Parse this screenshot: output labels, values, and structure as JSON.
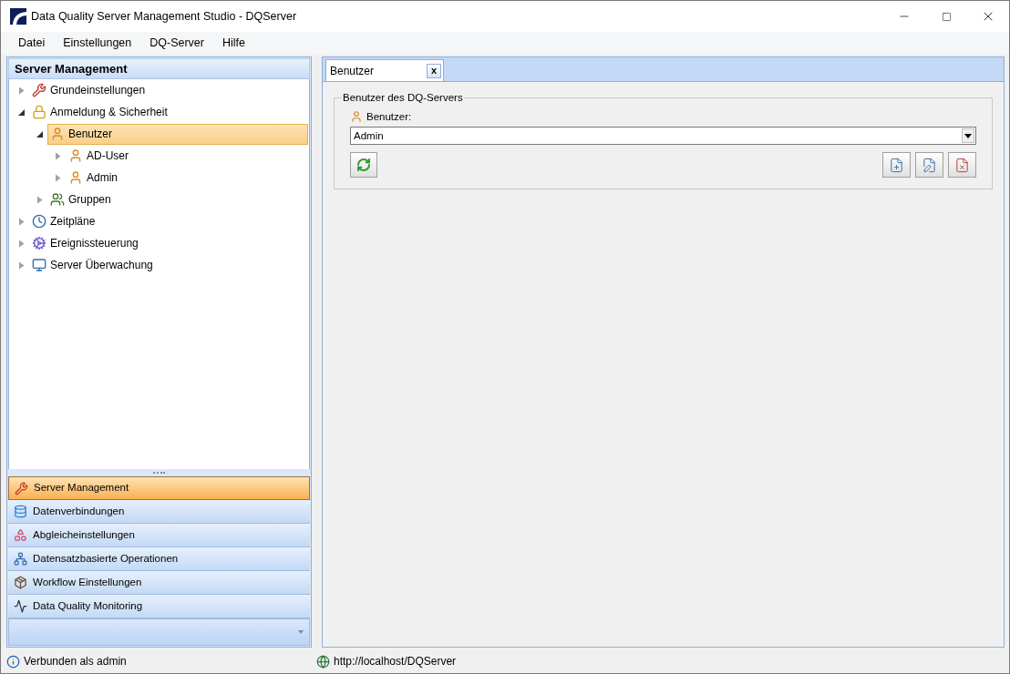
{
  "window": {
    "title": "Data Quality Server Management Studio - DQServer"
  },
  "menu": [
    "Datei",
    "Einstellungen",
    "DQ-Server",
    "Hilfe"
  ],
  "sidebar": {
    "title": "Server Management",
    "tree": [
      {
        "label": "Grundeinstellungen",
        "expanded": false,
        "selected": false
      },
      {
        "label": "Anmeldung & Sicherheit",
        "expanded": true,
        "selected": false,
        "children": [
          {
            "label": "Benutzer",
            "expanded": true,
            "selected": true,
            "children": [
              {
                "label": "AD-User",
                "expanded": false,
                "selected": false
              },
              {
                "label": "Admin",
                "expanded": false,
                "selected": false
              }
            ]
          },
          {
            "label": "Gruppen",
            "expanded": false,
            "selected": false
          }
        ]
      },
      {
        "label": "Zeitpläne",
        "expanded": false,
        "selected": false
      },
      {
        "label": "Ereignissteuerung",
        "expanded": false,
        "selected": false
      },
      {
        "label": "Server Überwachung",
        "expanded": false,
        "selected": false
      }
    ],
    "nav": [
      {
        "label": "Server Management",
        "selected": true
      },
      {
        "label": "Datenverbindungen",
        "selected": false
      },
      {
        "label": "Abgleicheinstellungen",
        "selected": false
      },
      {
        "label": "Datensatzbasierte Operationen",
        "selected": false
      },
      {
        "label": "Workflow Einstellungen",
        "selected": false
      },
      {
        "label": "Data Quality Monitoring",
        "selected": false
      }
    ]
  },
  "tabs": [
    {
      "label": "Benutzer",
      "selected": true,
      "close": "x"
    }
  ],
  "group": {
    "title": "Benutzer des DQ-Servers",
    "field_label": "Benutzer:",
    "value": "Admin"
  },
  "status_bar": {
    "left": "Verbunden als admin",
    "right": "http://localhost/DQServer"
  }
}
